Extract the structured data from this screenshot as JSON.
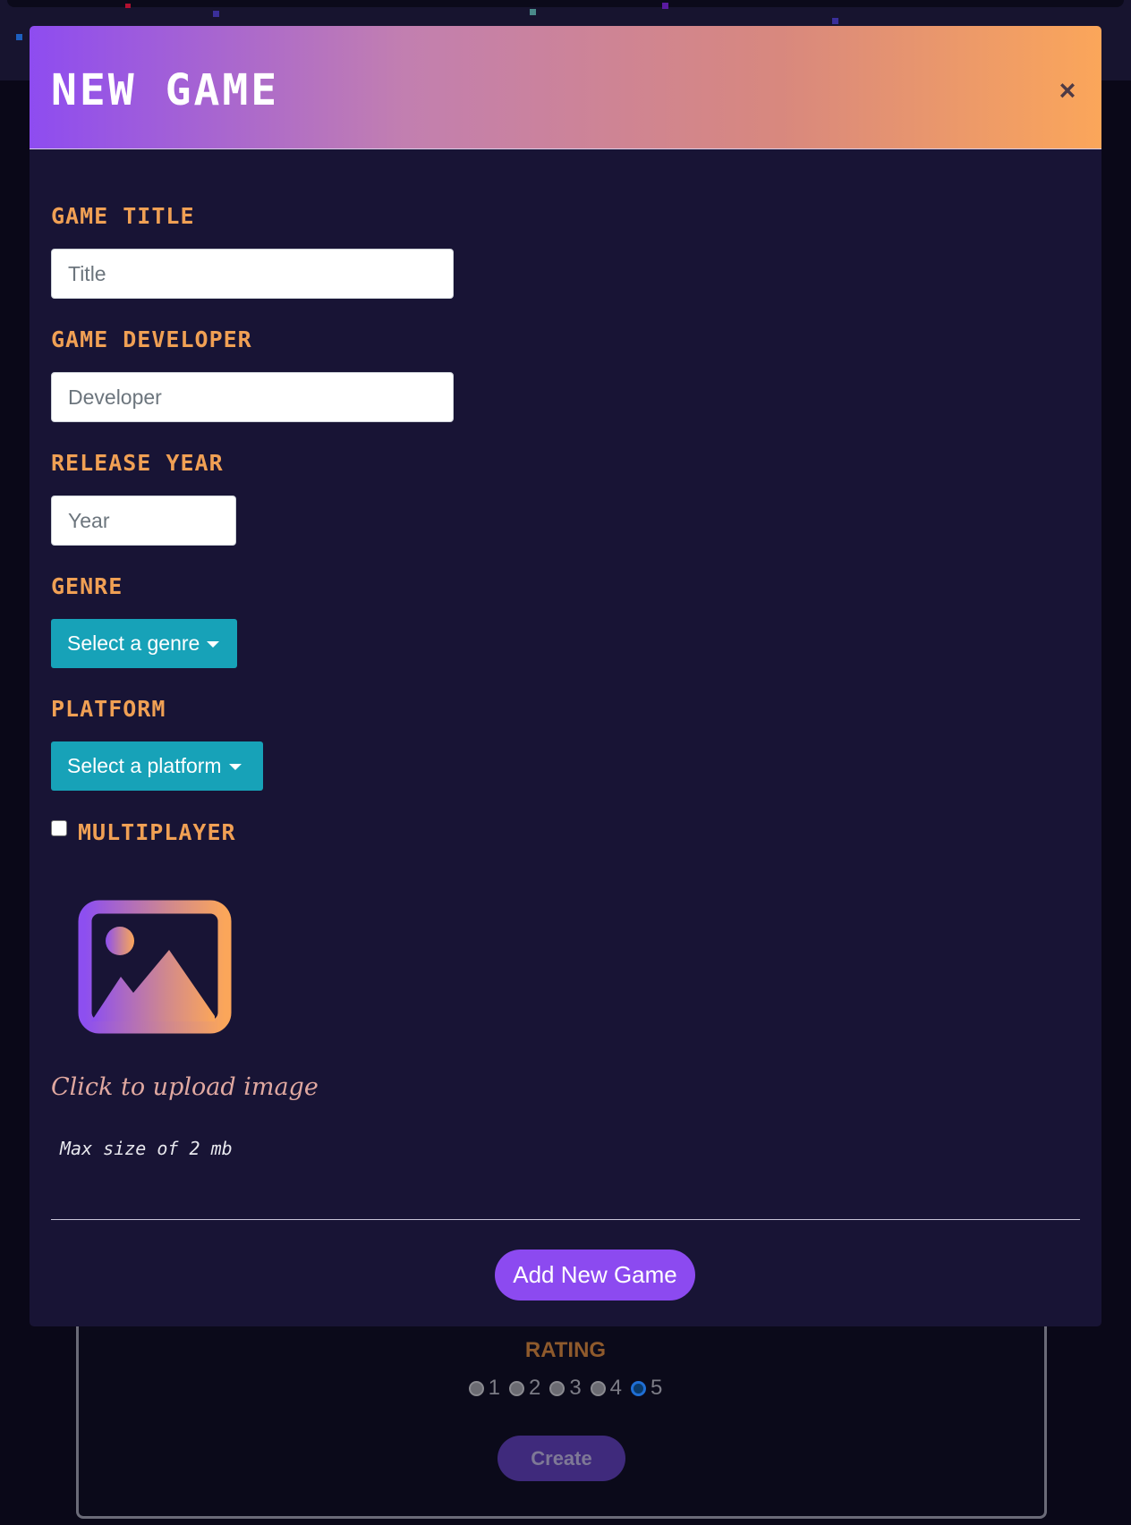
{
  "modal": {
    "title": "New Game",
    "close_symbol": "×"
  },
  "form": {
    "title_label": "Game Title",
    "title_placeholder": "Title",
    "developer_label": "Game Developer",
    "developer_placeholder": "Developer",
    "year_label": "Release Year",
    "year_placeholder": "Year",
    "genre_label": "Genre",
    "genre_button": "Select a genre",
    "platform_label": "Platform",
    "platform_button": "Select a platform",
    "multiplayer_label": "Multiplayer",
    "multiplayer_checked": false,
    "image_icon": "image-upload-icon",
    "upload_text": "Click to upload image",
    "max_size_text": "Max size of 2 mb",
    "submit_label": "Add New Game"
  },
  "background": {
    "rating_label": "RATING",
    "rating_options": [
      "1",
      "2",
      "3",
      "4",
      "5"
    ],
    "rating_selected": "5",
    "create_label": "Create"
  },
  "colors": {
    "header_gradient_start": "#8e4cf0",
    "header_gradient_end": "#fba65a",
    "label_orange": "#f0a054",
    "dropdown_teal": "#17a2b8",
    "submit_purple": "#8c4af0",
    "modal_bg": "#181435"
  }
}
